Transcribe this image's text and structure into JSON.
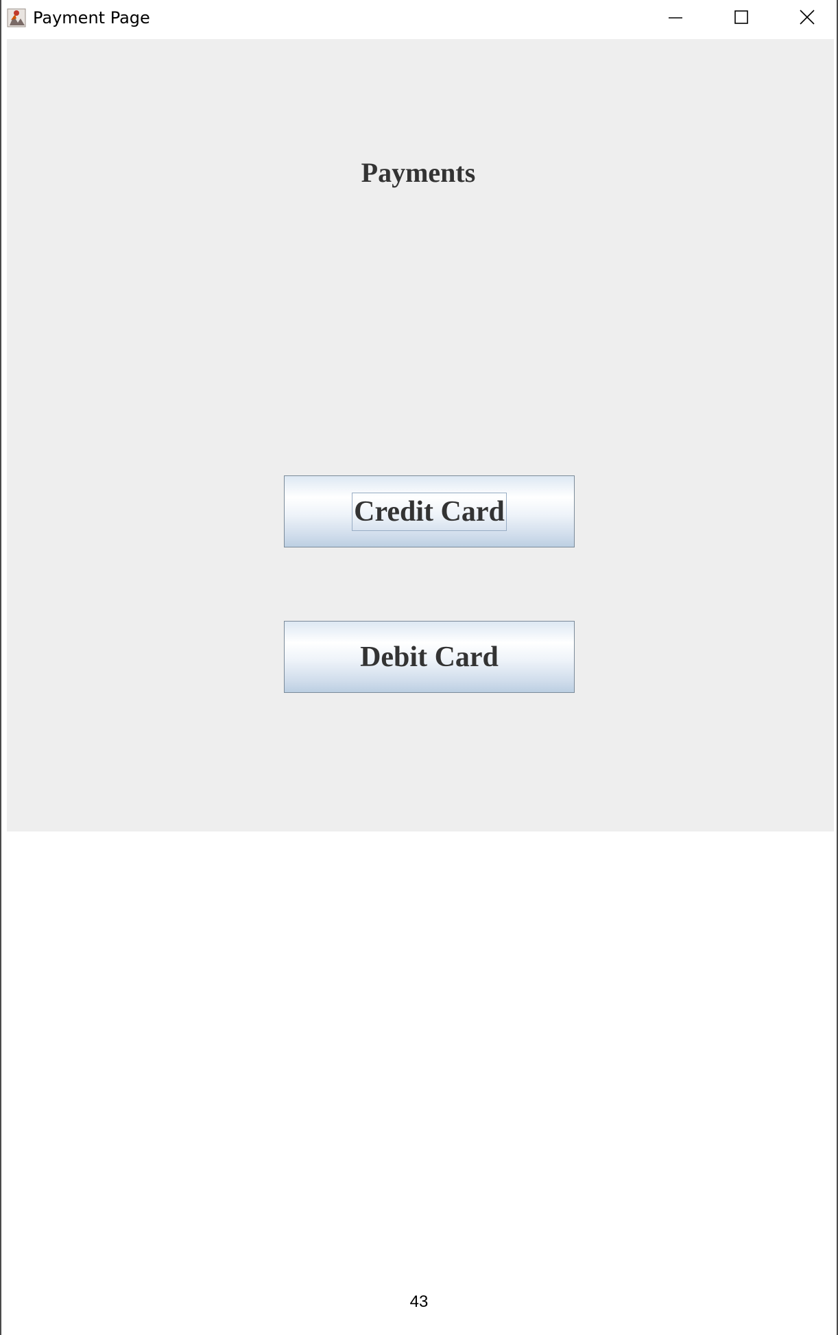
{
  "window": {
    "title": "Payment Page",
    "icon": "java-app-icon",
    "controls": [
      "minimize-icon",
      "maximize-icon",
      "close-icon"
    ]
  },
  "main": {
    "heading": "Payments",
    "buttons": [
      {
        "label": "Credit Card",
        "focused": true
      },
      {
        "label": "Debit Card",
        "focused": false
      }
    ]
  },
  "page_number": "43",
  "colors": {
    "content_background": "#eeeeee",
    "button_border": "#7a8a99",
    "text": "#333333"
  }
}
